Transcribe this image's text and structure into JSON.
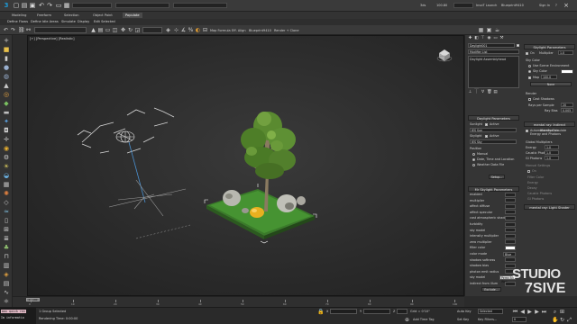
{
  "topbar": {
    "workspace_field": "",
    "title_fields": [
      "",
      ""
    ],
    "right_texts": [
      "3ds",
      "100.80",
      "InvoT Launch",
      "Blueprint9410",
      "Sign In",
      "?"
    ]
  },
  "ribbon": {
    "tabs": [
      "Modeling",
      "Freeform",
      "Selection",
      "Object Paint",
      "Populate"
    ],
    "active_tab": 4
  },
  "menu": {
    "items": [
      "Define Flows",
      "Define Idle Areas",
      "Simulate",
      "Display",
      "Edit Selected"
    ]
  },
  "toolbar": {
    "selection_filter": "",
    "view_dropdown": "",
    "named_selection": "",
    "buttons": [
      "Map Formula",
      "Eff. Align",
      "Blueprint9410",
      "Render + Clone"
    ]
  },
  "viewport": {
    "label": "[+] [Perspective] [Realistic]"
  },
  "right_panel": {
    "top_tab_icons": [
      "create-icon",
      "modify-icon",
      "hierarchy-icon",
      "motion-icon",
      "display-icon",
      "utilities-icon"
    ],
    "object_name": "Daylight001",
    "modifier_list_label": "Modifier List",
    "stack_item": "Daylight Assemblyhead",
    "skylight_params": {
      "title": "Skylight Parameters",
      "on_label": "On",
      "multiplier_label": "Multiplier",
      "multiplier_value": "1.0",
      "sky_color_label": "Sky Color",
      "use_scene_env": "Use Scene Environment",
      "sky_color": "Sky Color",
      "map_label": "Map",
      "map_value": "100.0",
      "none_button": "None",
      "render_label": "Render",
      "cast_shadows": "Cast Shadows",
      "rays_per_sample_label": "Rays per Sample",
      "rays_per_sample_value": "20",
      "ray_bias_label": "Ray Bias",
      "ray_bias_value": "0.005"
    },
    "daylight_params": {
      "title": "Daylight Parameters",
      "sunlight_label": "Sunlight",
      "active_label": "Active",
      "sunlight_value": "IES Sun",
      "skylight_label": "Skylight",
      "skylight_active_label": "Active",
      "skylight_value": "IES Sky",
      "position_label": "Position",
      "manual": "Manual",
      "date_time": "Date, Time and Location",
      "weather": "Weather Data File",
      "setup_button": "Setup..."
    },
    "mr_indirect": {
      "title": "mental ray: Indirect Illumination",
      "auto_calc": "Automatically Calculate Energy and Photons",
      "global_multipliers": "Global Multipliers",
      "energy_label": "Energy",
      "energy_value": "1.0",
      "caustic_photons_label": "Caustic Photons",
      "caustic_photons_value": "1.0",
      "gi_photons_label": "GI Photons",
      "gi_photons_value": "1.0",
      "manual_settings": "Manual Settings",
      "on_label": "On",
      "filter_color_label": "Filter Color",
      "energy2_label": "Energy",
      "decay_label": "Decay",
      "caustic_label": "Caustic Photons",
      "gi2_label": "GI Photons"
    },
    "mr_shader": {
      "title": "mental ray: Light Shader"
    },
    "mrsky_params": {
      "title": "Mr Skylight Parameters",
      "rows": [
        "enabled",
        "multiplier",
        "affect diffuse",
        "affect specular",
        "cast atmospheric shadows",
        "turbidity",
        "sky model",
        "intensity multiplier",
        "zero multiplier",
        "filter color",
        "color mode",
        "shadow softness",
        "shadow bias",
        "photon emit radius",
        "sky model",
        "indirect from illum"
      ],
      "color_mode_value": "Blue",
      "sky_model_value": "Perez All Wea",
      "exclude_button": "Exclude..."
    }
  },
  "timeline": {
    "slider_label": "0 / 100",
    "ticks": [
      "0",
      "10",
      "20",
      "30",
      "40",
      "50",
      "60",
      "70",
      "80",
      "90",
      "100"
    ]
  },
  "statusbar": {
    "maxscript_lines": [
      "max quick ren",
      "Im informatio"
    ],
    "selection_status": "1 Group Selected",
    "render_status": "Rendering Time: 0:00:00",
    "x_label": "X",
    "x_value": "",
    "y_label": "Y",
    "y_value": "",
    "z_label": "Z",
    "z_value": "",
    "grid": "Grid = 0'10\"",
    "autokey": "Auto Key",
    "selected_dropdown": "Selected",
    "setkey": "Set Key",
    "key_filters": "Key Filters...",
    "add_time_tag": "Add Time Tag",
    "frame_value": "0"
  },
  "watermark": {
    "line1": "STUDIO",
    "line2": "7SIVE"
  }
}
